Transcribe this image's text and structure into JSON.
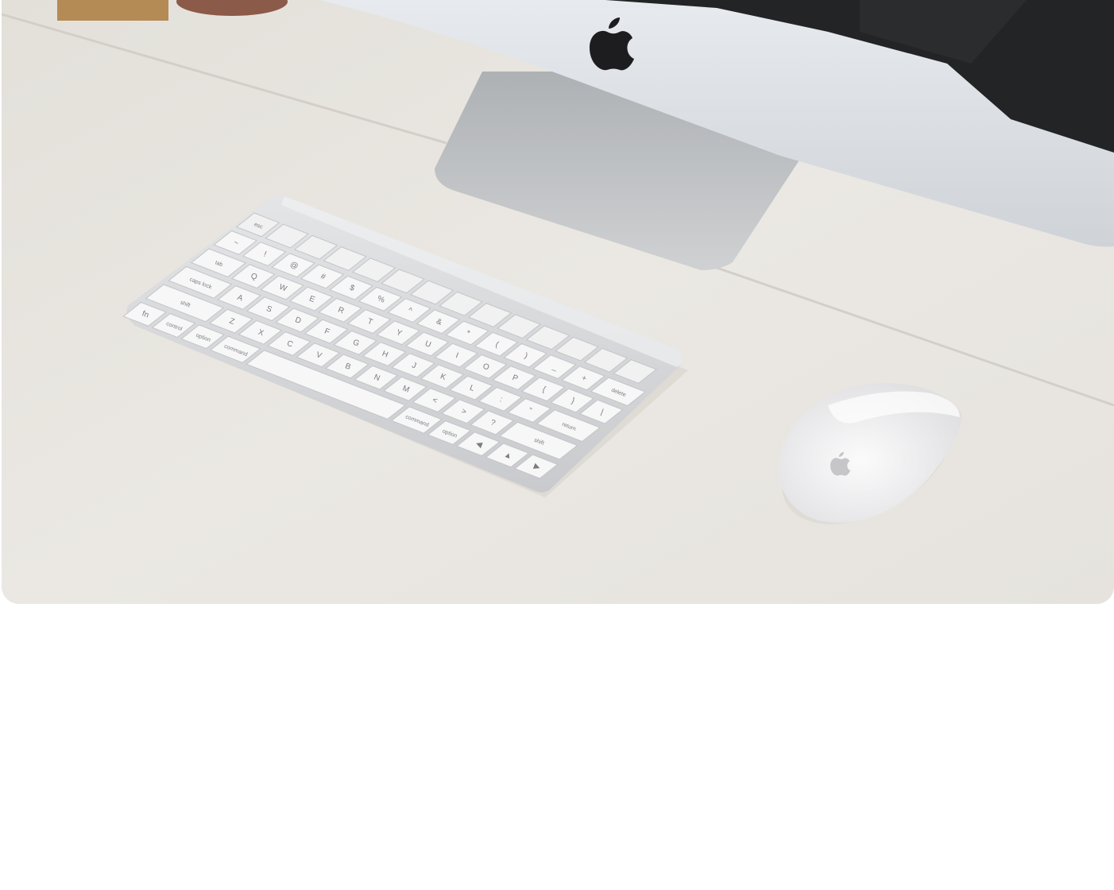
{
  "hero_image": {
    "alt": "",
    "objects": [
      "imac-monitor",
      "apple-logo-icon",
      "wireless-keyboard",
      "magic-mouse",
      "desk-surface"
    ],
    "colors": {
      "desk": "#ebe8e3",
      "desk_shadow": "#dcd8d1",
      "monitor_silver": "#d9dde2",
      "monitor_stand": "#c2c5c9",
      "screen": "#232425",
      "keyboard_body": "#d5d6d8",
      "key": "#f7f7f8",
      "mouse": "#f3f3f4"
    },
    "keyboard_rows": [
      [
        "esc",
        "",
        "",
        "",
        "",
        "",
        "",
        "",
        "",
        "",
        "",
        "",
        "",
        ""
      ],
      [
        "~",
        "!",
        "@",
        "#",
        "$",
        "%",
        "^",
        "&",
        "*",
        "(",
        ")",
        "_",
        "+",
        "delete"
      ],
      [
        "tab",
        "Q",
        "W",
        "E",
        "R",
        "T",
        "Y",
        "U",
        "I",
        "O",
        "P",
        "{",
        "}",
        "|"
      ],
      [
        "caps lock",
        "A",
        "S",
        "D",
        "F",
        "G",
        "H",
        "J",
        "K",
        "L",
        ":",
        "\"",
        "return"
      ],
      [
        "shift",
        "Z",
        "X",
        "C",
        "V",
        "B",
        "N",
        "M",
        "<",
        ">",
        "?",
        "shift"
      ],
      [
        "fn",
        "control",
        "option",
        "command",
        "",
        "command",
        "option",
        "◀",
        "▲",
        "▶"
      ]
    ]
  }
}
